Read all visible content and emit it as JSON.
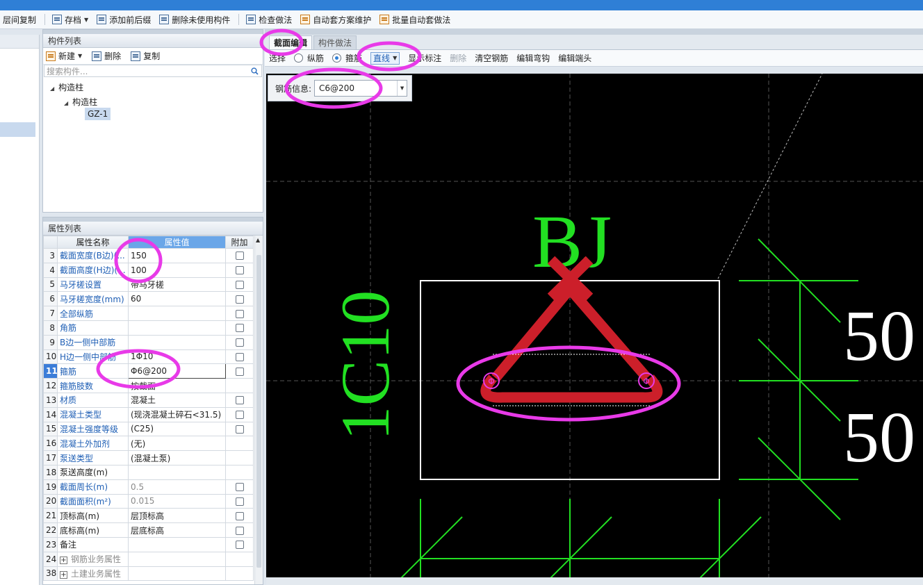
{
  "toolbar": {
    "items": [
      {
        "label": "层间复制",
        "icon": "copy-floor-icon"
      },
      {
        "label": "存档",
        "icon": "archive-icon"
      },
      {
        "label": "添加前后缀",
        "icon": "add-prefix-icon"
      },
      {
        "label": "删除未使用构件",
        "icon": "delete-unused-icon"
      },
      {
        "label": "检查做法",
        "icon": "check-method-icon"
      },
      {
        "label": "自动套方案维护",
        "icon": "auto-scheme-icon"
      },
      {
        "label": "批量自动套做法",
        "icon": "batch-auto-icon"
      }
    ]
  },
  "component_list": {
    "title": "构件列表",
    "new_label": "新建",
    "delete_label": "删除",
    "copy_label": "复制",
    "search_placeholder": "搜索构件...",
    "tree": {
      "root": "构造柱",
      "child": "构造柱",
      "item": "GZ-1"
    }
  },
  "property_list": {
    "title": "属性列表",
    "columns": {
      "name": "属性名称",
      "value": "属性值",
      "add": "附加"
    },
    "rows": [
      {
        "num": "3",
        "name": "截面宽度(B边)(...",
        "value": "150",
        "cb": true
      },
      {
        "num": "4",
        "name": "截面高度(H边)(...",
        "value": "100",
        "cb": true
      },
      {
        "num": "5",
        "name": "马牙槎设置",
        "value": "带马牙槎",
        "cb": true
      },
      {
        "num": "6",
        "name": "马牙槎宽度(mm)",
        "value": "60",
        "cb": true
      },
      {
        "num": "7",
        "name": "全部纵筋",
        "value": "",
        "cb": true
      },
      {
        "num": "8",
        "name": "角筋",
        "value": "",
        "cb": true
      },
      {
        "num": "9",
        "name": "B边一侧中部筋",
        "value": "",
        "cb": true
      },
      {
        "num": "10",
        "name": "H边一侧中部筋",
        "value": "1Φ10",
        "cb": true
      },
      {
        "num": "11",
        "name": "箍筋",
        "value": "Φ6@200",
        "cb": true,
        "active": true
      },
      {
        "num": "12",
        "name": "箍筋肢数",
        "value": "按截面",
        "cb": false
      },
      {
        "num": "13",
        "name": "材质",
        "value": "混凝土",
        "cb": true
      },
      {
        "num": "14",
        "name": "混凝土类型",
        "value": "(现浇混凝土碎石<31.5)",
        "cb": true
      },
      {
        "num": "15",
        "name": "混凝土强度等级",
        "value": "(C25)",
        "cb": true
      },
      {
        "num": "16",
        "name": "混凝土外加剂",
        "value": "(无)",
        "cb": false
      },
      {
        "num": "17",
        "name": "泵送类型",
        "value": "(混凝土泵)",
        "cb": false
      },
      {
        "num": "18",
        "name": "泵送高度(m)",
        "value": "",
        "cb": false,
        "black": true
      },
      {
        "num": "19",
        "name": "截面周长(m)",
        "value": "0.5",
        "cb": true,
        "gray": true
      },
      {
        "num": "20",
        "name": "截面面积(m²)",
        "value": "0.015",
        "cb": true,
        "gray": true
      },
      {
        "num": "21",
        "name": "顶标高(m)",
        "value": "层顶标高",
        "cb": true,
        "black": true
      },
      {
        "num": "22",
        "name": "底标高(m)",
        "value": "层底标高",
        "cb": true,
        "black": true
      },
      {
        "num": "23",
        "name": "备注",
        "value": "",
        "cb": true,
        "black": true
      },
      {
        "num": "24",
        "name": "钢筋业务属性",
        "value": "",
        "cb": false,
        "group": true
      },
      {
        "num": "38",
        "name": "土建业务属性",
        "value": "",
        "cb": false,
        "group": true
      }
    ]
  },
  "editor": {
    "tabs": [
      {
        "label": "截面编辑",
        "active": true
      },
      {
        "label": "构件做法",
        "active": false
      }
    ],
    "tools": {
      "select": "选择",
      "longitudinal": "纵筋",
      "stirrup": "箍筋",
      "line_mode": "直线",
      "show_label": "显示标注",
      "delete": "删除",
      "clear_rebar": "清空钢筋",
      "edit_hook": "编辑弯钩",
      "edit_end": "编辑端头"
    },
    "rebar_info_label": "钢筋信息:",
    "rebar_info_value": "C6@200",
    "drawing": {
      "label_bj": "BJ",
      "label_side": "1C10",
      "dim_top": "50",
      "dim_bottom": "50"
    },
    "colors": {
      "green": "#22e022",
      "red": "#cc1f2a",
      "magenta": "#e83ae8"
    }
  }
}
